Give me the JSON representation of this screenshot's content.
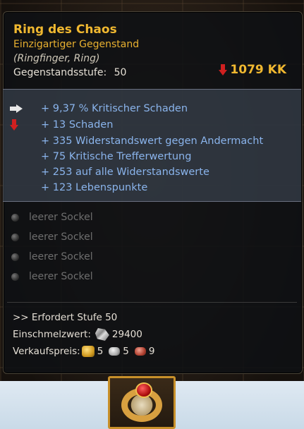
{
  "item": {
    "name": "Ring des Chaos",
    "rarity": "Einzigartiger Gegenstand",
    "slot": "(Ringfinger, Ring)",
    "level_label": "Gegenstandsstufe:",
    "level_value": "50",
    "price_change": "1079 KK"
  },
  "stats": [
    {
      "text": "+ 9,37 % Kritischer Schaden",
      "indicator": "up-arrow-white"
    },
    {
      "text": "+ 13 Schaden",
      "indicator": "down-arrow-red"
    },
    {
      "text": "+ 335 Widerstandswert gegen Andermacht",
      "indicator": ""
    },
    {
      "text": "+ 75 Kritische Trefferwertung",
      "indicator": ""
    },
    {
      "text": "+ 253 auf alle Widerstandswerte",
      "indicator": ""
    },
    {
      "text": "+ 123 Lebenspunkte",
      "indicator": ""
    }
  ],
  "sockets": [
    "leerer Sockel",
    "leerer Sockel",
    "leerer Sockel",
    "leerer Sockel"
  ],
  "footer": {
    "requirement": ">> Erfordert Stufe 50",
    "smelt_label": "Einschmelzwert:",
    "smelt_value": "29400",
    "sell_label": "Verkaufspreis:",
    "sell_gold": "5",
    "sell_silver": "5",
    "sell_copper": "9"
  },
  "colors": {
    "title": "#f0b830",
    "stat": "#8ab4ec",
    "socket": "#6e6e6e"
  }
}
